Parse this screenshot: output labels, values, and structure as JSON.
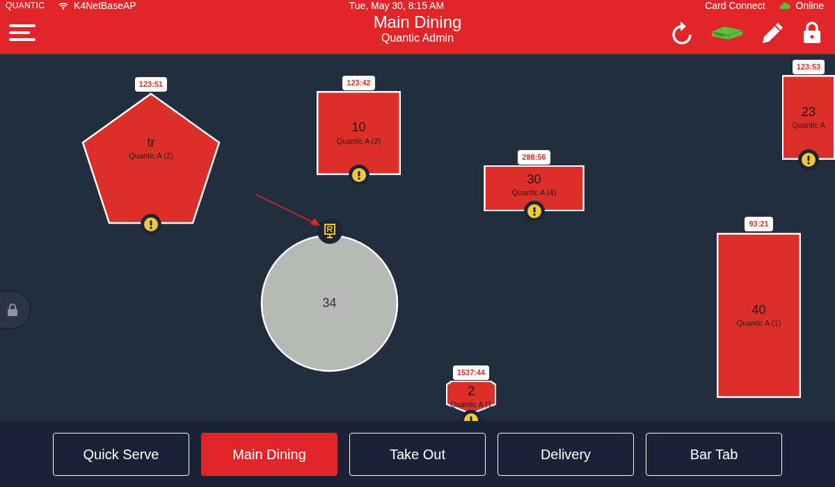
{
  "status_bar": {
    "brand": "QUANTIC",
    "network": "K4NetBaseAP",
    "datetime": "Tue, May 30, 8:15 AM",
    "payment": "Card Connect",
    "connection": "Online"
  },
  "header": {
    "title": "Main Dining",
    "subtitle": "Quantic Admin"
  },
  "floor": {
    "tables": [
      {
        "kind": "pentagon",
        "name": "tr",
        "server": "Quantic A (2)",
        "timer": "123:51",
        "occupied": true,
        "alert": true,
        "reserved": false
      },
      {
        "kind": "rect",
        "name": "10",
        "server": "Quantic A (2)",
        "timer": "123:42",
        "occupied": true,
        "alert": true,
        "reserved": false
      },
      {
        "kind": "rect",
        "name": "30",
        "server": "Quantic A (4)",
        "timer": "288:56",
        "occupied": true,
        "alert": true,
        "reserved": false
      },
      {
        "kind": "rect",
        "name": "23",
        "server": "Quantic A",
        "timer": "123:53",
        "occupied": true,
        "alert": true,
        "reserved": false
      },
      {
        "kind": "circle",
        "name": "34",
        "occupied": false,
        "alert": false,
        "reserved": true
      },
      {
        "kind": "rect",
        "name": "40",
        "server": "Quantic A (1)",
        "timer": "93:21",
        "occupied": true,
        "alert": false,
        "reserved": false
      },
      {
        "kind": "hexagon",
        "name": "2",
        "server": "Quantic A (1",
        "timer": "1537:44",
        "occupied": true,
        "alert": true,
        "reserved": false
      }
    ]
  },
  "sections": [
    {
      "label": "Quick Serve",
      "selected": false
    },
    {
      "label": "Main Dining",
      "selected": true
    },
    {
      "label": "Take Out",
      "selected": false
    },
    {
      "label": "Delivery",
      "selected": false
    },
    {
      "label": "Bar Tab",
      "selected": false
    }
  ]
}
